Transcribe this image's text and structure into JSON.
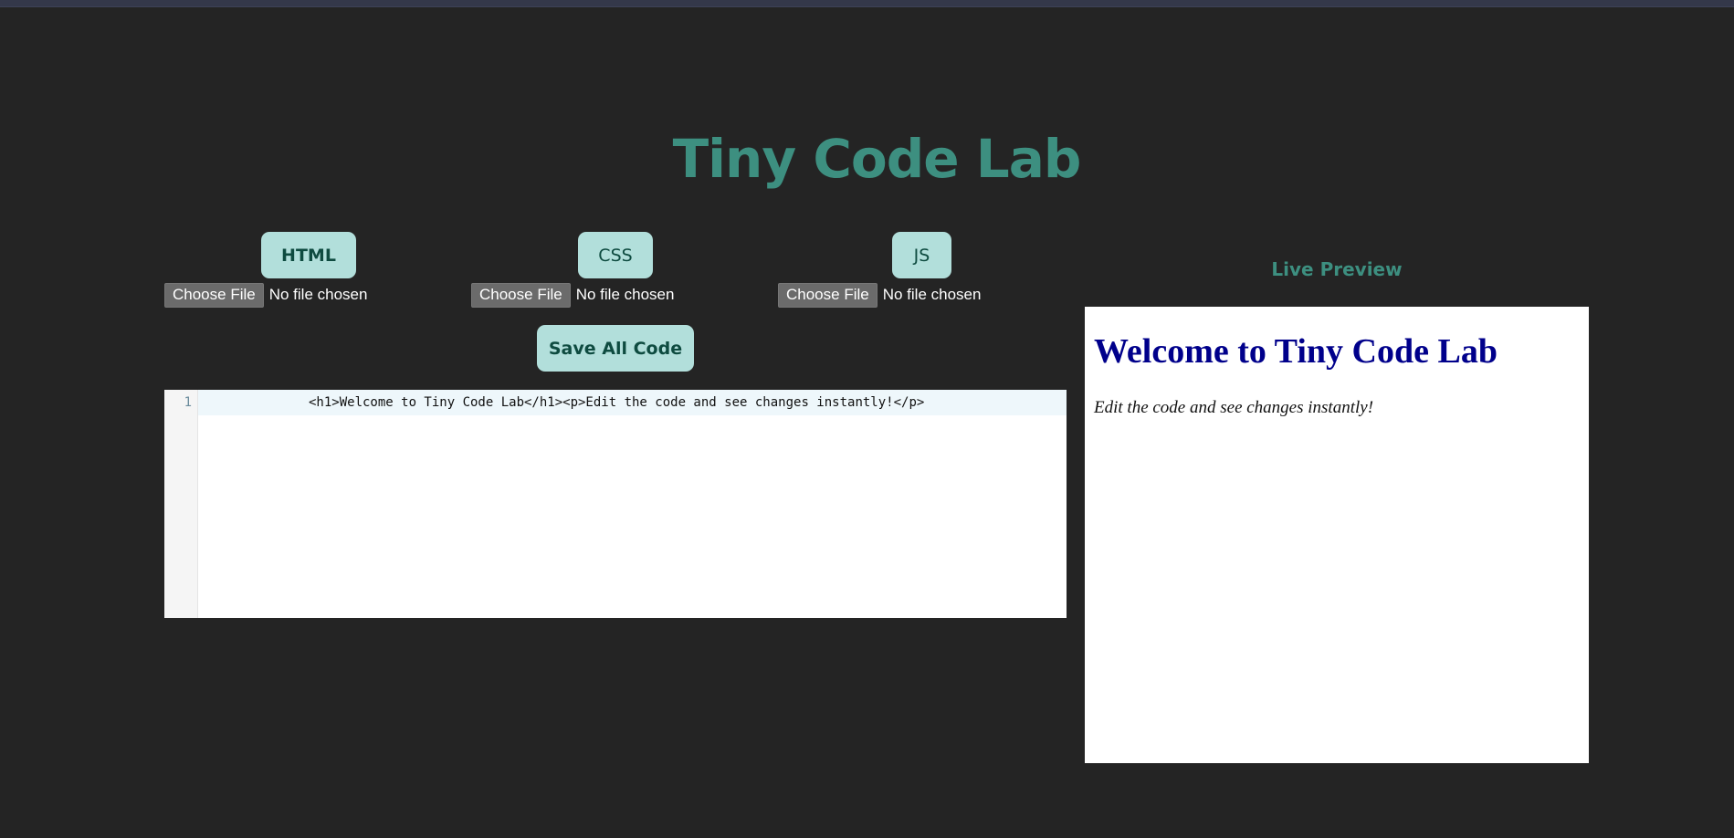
{
  "app": {
    "title": "Tiny Code Lab"
  },
  "tabs": [
    {
      "label": "HTML",
      "active": true
    },
    {
      "label": "CSS",
      "active": false
    },
    {
      "label": "JS",
      "active": false
    }
  ],
  "file_pickers": [
    {
      "button_label": "Choose File",
      "status": "No file chosen"
    },
    {
      "button_label": "Choose File",
      "status": "No file chosen"
    },
    {
      "button_label": "Choose File",
      "status": "No file chosen"
    }
  ],
  "save_label": "Save All Code",
  "editor": {
    "line_number": "1",
    "code": "<h1>Welcome to Tiny Code Lab</h1><p>Edit the code and see changes instantly!</p>"
  },
  "preview": {
    "heading": "Live Preview",
    "h1": "Welcome to Tiny Code Lab",
    "p": "Edit the code and see changes instantly!"
  },
  "colors": {
    "background": "#242424",
    "accent": "#3d8f80",
    "button_bg": "#b2dfdb",
    "button_text": "#0e4b40",
    "preview_heading_text": "#00008b"
  }
}
